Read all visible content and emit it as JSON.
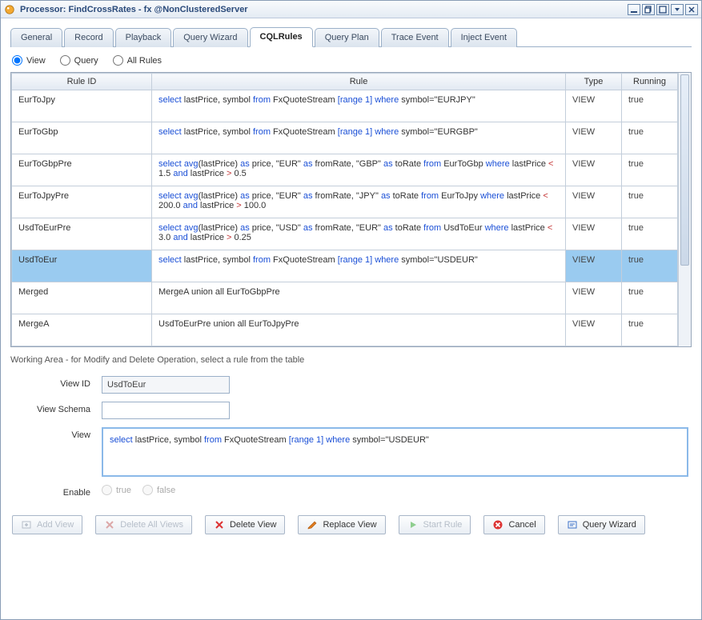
{
  "window": {
    "title": "Processor: FindCrossRates - fx @NonClusteredServer"
  },
  "tabs": [
    {
      "label": "General"
    },
    {
      "label": "Record"
    },
    {
      "label": "Playback"
    },
    {
      "label": "Query Wizard"
    },
    {
      "label": "CQLRules",
      "active": true
    },
    {
      "label": "Query Plan"
    },
    {
      "label": "Trace Event"
    },
    {
      "label": "Inject Event"
    }
  ],
  "radio_filter": {
    "options": [
      {
        "label": "View",
        "checked": true
      },
      {
        "label": "Query",
        "checked": false
      },
      {
        "label": "All Rules",
        "checked": false
      }
    ]
  },
  "table": {
    "headers": {
      "rule_id": "Rule ID",
      "rule": "Rule",
      "type": "Type",
      "running": "Running"
    },
    "rows": [
      {
        "rule_id": "EurToJpy",
        "type": "VIEW",
        "running": "true",
        "rule_tokens": [
          {
            "t": "select",
            "c": "kw"
          },
          {
            "t": " lastPrice, symbol "
          },
          {
            "t": "from",
            "c": "kw"
          },
          {
            "t": " FxQuoteStream "
          },
          {
            "t": "[range 1]",
            "c": "kw"
          },
          {
            "t": " "
          },
          {
            "t": "where",
            "c": "kw"
          },
          {
            "t": " symbol=\"EURJPY\""
          }
        ]
      },
      {
        "rule_id": "EurToGbp",
        "type": "VIEW",
        "running": "true",
        "rule_tokens": [
          {
            "t": "select",
            "c": "kw"
          },
          {
            "t": " lastPrice, symbol "
          },
          {
            "t": "from",
            "c": "kw"
          },
          {
            "t": " FxQuoteStream "
          },
          {
            "t": "[range 1]",
            "c": "kw"
          },
          {
            "t": " "
          },
          {
            "t": "where",
            "c": "kw"
          },
          {
            "t": " symbol=\"EURGBP\""
          }
        ]
      },
      {
        "rule_id": "EurToGbpPre",
        "type": "VIEW",
        "running": "true",
        "rule_tokens": [
          {
            "t": "select",
            "c": "kw"
          },
          {
            "t": " "
          },
          {
            "t": "avg",
            "c": "kw"
          },
          {
            "t": "(lastPrice) "
          },
          {
            "t": "as",
            "c": "kw"
          },
          {
            "t": " price, \"EUR\" "
          },
          {
            "t": "as",
            "c": "kw"
          },
          {
            "t": " fromRate, \"GBP\" "
          },
          {
            "t": "as",
            "c": "kw"
          },
          {
            "t": " toRate "
          },
          {
            "t": "from",
            "c": "kw"
          },
          {
            "t": " EurToGbp "
          },
          {
            "t": "where",
            "c": "kw"
          },
          {
            "t": " lastPrice "
          },
          {
            "t": "<",
            "c": "cmp"
          },
          {
            "t": " 1.5 "
          },
          {
            "t": "and",
            "c": "kw"
          },
          {
            "t": " lastPrice "
          },
          {
            "t": ">",
            "c": "cmp"
          },
          {
            "t": " 0.5"
          }
        ]
      },
      {
        "rule_id": "EurToJpyPre",
        "type": "VIEW",
        "running": "true",
        "rule_tokens": [
          {
            "t": "select",
            "c": "kw"
          },
          {
            "t": " "
          },
          {
            "t": "avg",
            "c": "kw"
          },
          {
            "t": "(lastPrice) "
          },
          {
            "t": "as",
            "c": "kw"
          },
          {
            "t": " price, \"EUR\" "
          },
          {
            "t": "as",
            "c": "kw"
          },
          {
            "t": " fromRate, \"JPY\" "
          },
          {
            "t": "as",
            "c": "kw"
          },
          {
            "t": " toRate "
          },
          {
            "t": "from",
            "c": "kw"
          },
          {
            "t": " EurToJpy "
          },
          {
            "t": "where",
            "c": "kw"
          },
          {
            "t": " lastPrice "
          },
          {
            "t": "<",
            "c": "cmp"
          },
          {
            "t": " 200.0 "
          },
          {
            "t": "and",
            "c": "kw"
          },
          {
            "t": " lastPrice "
          },
          {
            "t": ">",
            "c": "cmp"
          },
          {
            "t": " 100.0"
          }
        ]
      },
      {
        "rule_id": "UsdToEurPre",
        "type": "VIEW",
        "running": "true",
        "rule_tokens": [
          {
            "t": "select",
            "c": "kw"
          },
          {
            "t": " "
          },
          {
            "t": "avg",
            "c": "kw"
          },
          {
            "t": "(lastPrice) "
          },
          {
            "t": "as",
            "c": "kw"
          },
          {
            "t": " price, \"USD\" "
          },
          {
            "t": "as",
            "c": "kw"
          },
          {
            "t": " fromRate, \"EUR\" "
          },
          {
            "t": "as",
            "c": "kw"
          },
          {
            "t": " toRate "
          },
          {
            "t": "from",
            "c": "kw"
          },
          {
            "t": " UsdToEur "
          },
          {
            "t": "where",
            "c": "kw"
          },
          {
            "t": " lastPrice "
          },
          {
            "t": "<",
            "c": "cmp"
          },
          {
            "t": " 3.0 "
          },
          {
            "t": "and",
            "c": "kw"
          },
          {
            "t": " lastPrice "
          },
          {
            "t": ">",
            "c": "cmp"
          },
          {
            "t": " 0.25"
          }
        ]
      },
      {
        "rule_id": "UsdToEur",
        "type": "VIEW",
        "running": "true",
        "selected": true,
        "rule_tokens": [
          {
            "t": "select",
            "c": "kw"
          },
          {
            "t": " lastPrice, symbol "
          },
          {
            "t": "from",
            "c": "kw"
          },
          {
            "t": " FxQuoteStream "
          },
          {
            "t": "[range 1]",
            "c": "kw"
          },
          {
            "t": " "
          },
          {
            "t": "where",
            "c": "kw"
          },
          {
            "t": " symbol=\"USDEUR\""
          }
        ]
      },
      {
        "rule_id": "Merged",
        "type": "VIEW",
        "running": "true",
        "rule_tokens": [
          {
            "t": "MergeA union all EurToGbpPre"
          }
        ]
      },
      {
        "rule_id": "MergeA",
        "type": "VIEW",
        "running": "true",
        "rule_tokens": [
          {
            "t": "UsdToEurPre union all EurToJpyPre"
          }
        ]
      }
    ]
  },
  "working_area_hint": "Working Area - for Modify and Delete Operation, select a rule from the table",
  "form": {
    "view_id": {
      "label": "View ID",
      "value": "UsdToEur"
    },
    "view_schema": {
      "label": "View Schema",
      "value": ""
    },
    "view": {
      "label": "View",
      "tokens": [
        {
          "t": "select",
          "c": "kw"
        },
        {
          "t": " lastPrice, symbol "
        },
        {
          "t": "from",
          "c": "kw"
        },
        {
          "t": " FxQuoteStream "
        },
        {
          "t": "[range 1]",
          "c": "kw"
        },
        {
          "t": " "
        },
        {
          "t": "where",
          "c": "kw"
        },
        {
          "t": " symbol=\"USDEUR\""
        }
      ]
    },
    "enable": {
      "label": "Enable",
      "true_label": "true",
      "false_label": "false"
    }
  },
  "buttons": {
    "add_view": "Add View",
    "delete_all_views": "Delete All Views",
    "delete_view": "Delete View",
    "replace_view": "Replace View",
    "start_rule": "Start Rule",
    "cancel": "Cancel",
    "query_wizard": "Query Wizard"
  },
  "icon_colors": {
    "accent_blue": "#3d72c9",
    "green": "#3aa23a",
    "red": "#d33",
    "orange": "#e07b1f",
    "gray": "#b6bec9"
  }
}
